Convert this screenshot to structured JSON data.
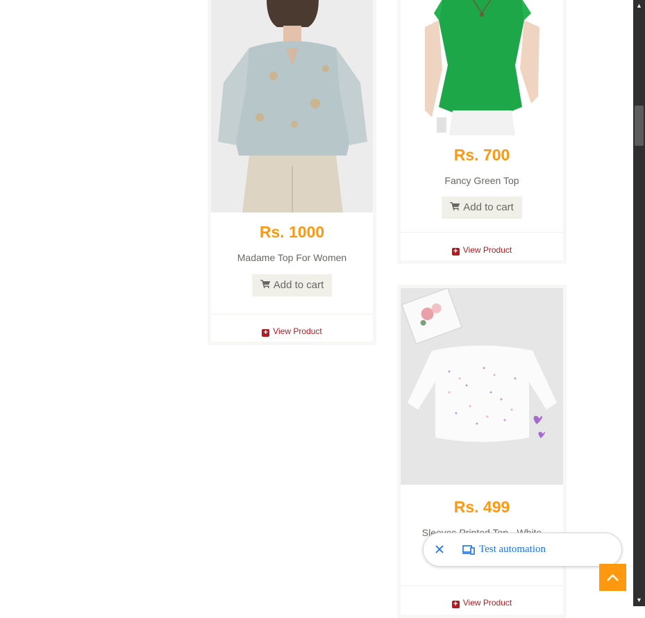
{
  "products": [
    {
      "price": "Rs. 1000",
      "name": "Madame Top For Women",
      "add_to_cart": "Add to cart",
      "view_product": "View Product"
    },
    {
      "price": "Rs. 700",
      "name": "Fancy Green Top",
      "add_to_cart": "Add to cart",
      "view_product": "View Product"
    },
    {
      "price": "Rs. 499",
      "name": "Sleeves Printed Top - White",
      "view_product": "View Product"
    }
  ],
  "test_automation": {
    "label": "Test automation"
  },
  "colors": {
    "price": "#fe980f",
    "link": "#b3191e",
    "button_bg": "#f0f0e9",
    "scroll_top": "#fe980f"
  },
  "icons": [
    "shopping-cart-icon",
    "plus-square-icon",
    "close-icon",
    "devices-icon",
    "chevron-up-icon"
  ]
}
